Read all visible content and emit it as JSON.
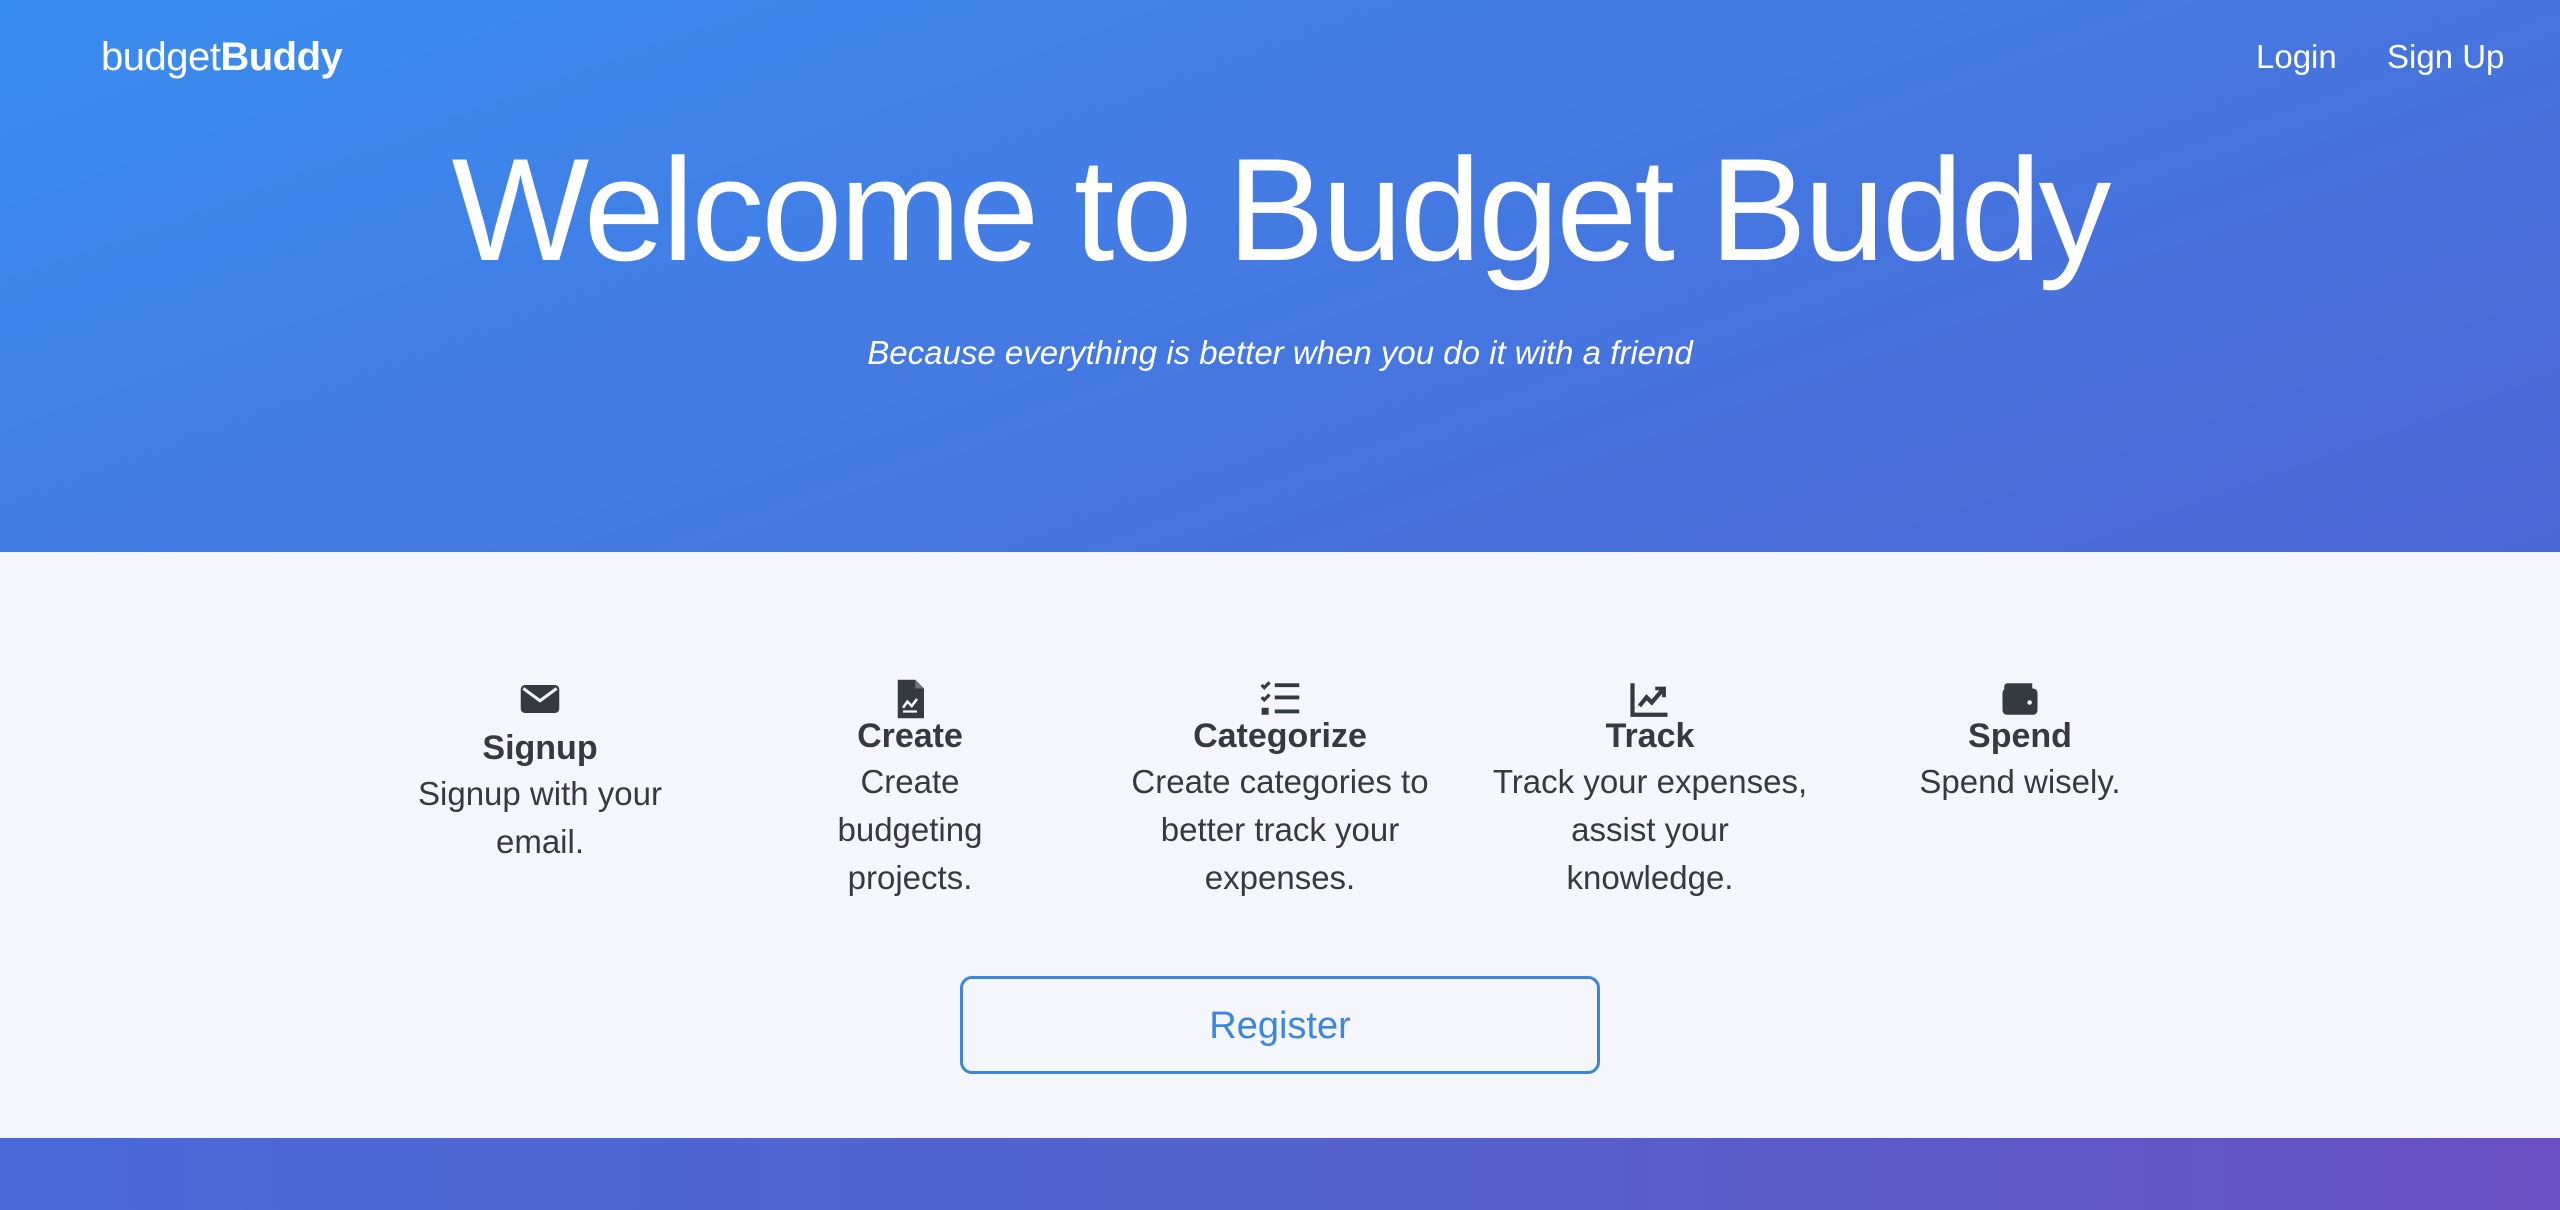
{
  "brand": {
    "prefix": "budget",
    "bold": "Buddy"
  },
  "nav": {
    "login": "Login",
    "signup": "Sign Up"
  },
  "hero": {
    "title": "Welcome to Budget Buddy",
    "subtitle": "Because everything is better when you do it with a friend"
  },
  "features": [
    {
      "icon": "envelope-icon",
      "title": "Signup",
      "description": "Signup with your email."
    },
    {
      "icon": "document-icon",
      "title": "Create",
      "description": "Create budgeting projects."
    },
    {
      "icon": "checklist-icon",
      "title": "Categorize",
      "description": "Create categories to better track your expenses."
    },
    {
      "icon": "chart-line-icon",
      "title": "Track",
      "description": "Track your expenses, assist your knowledge."
    },
    {
      "icon": "wallet-icon",
      "title": "Spend",
      "description": "Spend wisely."
    }
  ],
  "register_label": "Register",
  "colors": {
    "hero_start": "#3a8df0",
    "hero_end": "#4d66d6",
    "accent": "#3a86e0",
    "text_dark": "#343a40",
    "section_bg": "#f4f6fb"
  }
}
